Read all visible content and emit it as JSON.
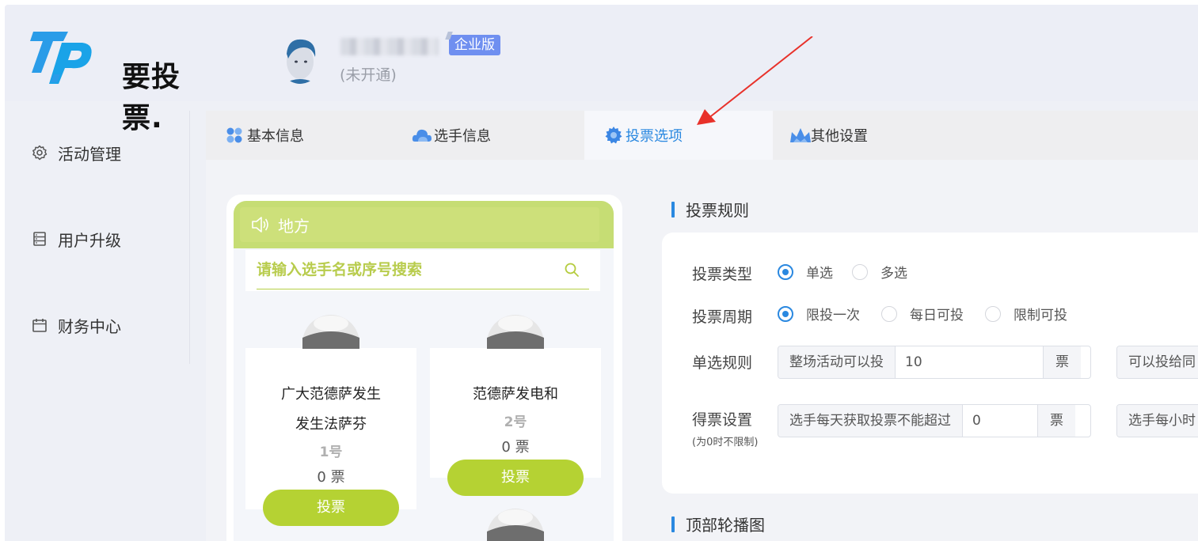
{
  "brand": {
    "name": "要投票."
  },
  "user": {
    "badge": "企业版",
    "status": "(未开通)"
  },
  "sidebar": {
    "items": [
      {
        "label": "活动管理",
        "icon": "gear-icon"
      },
      {
        "label": "用户升级",
        "icon": "list-icon"
      },
      {
        "label": "财务中心",
        "icon": "calendar-icon"
      }
    ]
  },
  "tabs": [
    {
      "label": "基本信息",
      "icon": "dots-icon"
    },
    {
      "label": "选手信息",
      "icon": "cloud-icon"
    },
    {
      "label": "投票选项",
      "icon": "gear-icon",
      "active": true
    },
    {
      "label": "其他设置",
      "icon": "crown-icon"
    }
  ],
  "preview": {
    "notice": "地方",
    "search_placeholder": "请输入选手名或序号搜索",
    "candidates": [
      {
        "name_line1": "广大范德萨发生",
        "name_line2": "发生法萨芬",
        "number": "1号",
        "votes": "0 票",
        "button": "投票"
      },
      {
        "name_line1": "范德萨发电和",
        "number": "2号",
        "votes": "0 票",
        "button": "投票"
      }
    ]
  },
  "rules": {
    "title": "投票规则",
    "vote_type": {
      "label": "投票类型",
      "options": [
        "单选",
        "多选"
      ],
      "selected": "单选"
    },
    "vote_period": {
      "label": "投票周期",
      "options": [
        "限投一次",
        "每日可投",
        "限制可投"
      ],
      "selected": "限投一次"
    },
    "single_rule": {
      "label": "单选规则",
      "prefix": "整场活动可以投",
      "value": "10",
      "suffix": "票",
      "prefix2": "可以投给同"
    },
    "vote_setting": {
      "label": "得票设置",
      "note": "(为0时不限制)",
      "prefix": "选手每天获取投票不能超过",
      "value": "0",
      "suffix": "票",
      "prefix2": "选手每小时"
    }
  },
  "carousel": {
    "title": "顶部轮播图"
  },
  "colors": {
    "accent": "#2a88e0",
    "green": "#b5d233",
    "notice": "#c6dd74",
    "annotation": "#e8312a"
  }
}
